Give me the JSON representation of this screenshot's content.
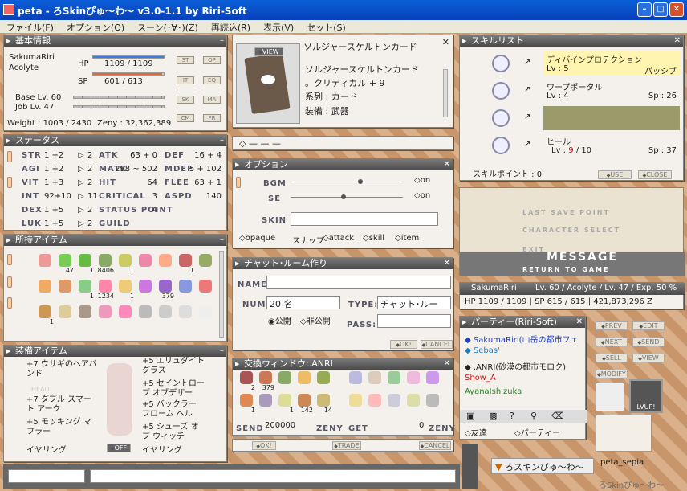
{
  "title": "peta - ろSkinぴゅ～わ～ v3.0-1.1 by Riri-Soft",
  "menu": [
    "ファイル(F)",
    "オプション(O)",
    "スーン(･∀･)(Z)",
    "再読込(R)",
    "表示(V)",
    "セット(S)"
  ],
  "basic": {
    "header": "基本情報",
    "name": "SakumaRiri",
    "job": "Acolyte",
    "hp_label": "HP",
    "hp": "1109 / 1109",
    "sp_label": "SP",
    "sp": "601 / 613",
    "hp_frac": 1.0,
    "sp_frac": 0.98,
    "base": "Base Lv. 60",
    "joblv": "Job Lv. 47",
    "weight": "Weight : 1003 / 2430",
    "zeny": "Zeny : 32,362,389",
    "btns": [
      "ST",
      "OP",
      "IT",
      "EQ",
      "SK",
      "MA",
      "CM",
      "FR"
    ]
  },
  "status": {
    "header": "ステータス",
    "rows": [
      {
        "k": "STR",
        "v": "1 +2",
        "p": "2",
        "k2": "ATK",
        "v2": "63 + 0",
        "k3": "DEF",
        "v3": "16 + 4"
      },
      {
        "k": "AGI",
        "v": "1 +2",
        "p": "2",
        "k2": "MATK",
        "v2": "298 ~ 502",
        "k3": "MDEF",
        "v3": "5 + 102"
      },
      {
        "k": "VIT",
        "v": "1 +3",
        "p": "2",
        "k2": "HIT",
        "v2": "64",
        "k3": "FLEE",
        "v3": "63 + 1"
      },
      {
        "k": "INT",
        "v": "92+10",
        "p": "11",
        "k2": "CRITICAL",
        "v2": "3",
        "k3": "ASPD",
        "v3": "140"
      },
      {
        "k": "DEX",
        "v": "1 +5",
        "p": "2",
        "k2": "STATUS POINT",
        "v2": "4",
        "k3": "",
        "v3": ""
      },
      {
        "k": "LUK",
        "v": "1 +5",
        "p": "2",
        "k2": "GUILD",
        "v2": "",
        "k3": "",
        "v3": ""
      }
    ]
  },
  "items": {
    "header": "所持アイテム",
    "counts": [
      "",
      "47",
      "1",
      "8406",
      "1",
      "",
      "",
      "1",
      "",
      "",
      "",
      "1",
      "1234",
      "1",
      "",
      "379",
      "",
      "",
      "1",
      "",
      "",
      "",
      "",
      "",
      "",
      "",
      ""
    ]
  },
  "equip": {
    "header": "装備アイテム",
    "left": [
      "+7 ウサギのヘアバンド",
      "HEAD",
      "+7 ダブル スマート アーク",
      "+5 モッキング マフラー",
      "イヤリング"
    ],
    "right": [
      "+5 エリュダイト グラス",
      "+5 セイントローブ オブデザー",
      "+5 バックラー フローム ヘル",
      "+5 シューズ オブ ウィッチ",
      "イヤリング"
    ],
    "off": "OFF"
  },
  "card": {
    "title": "ソルジャースケルトンカード",
    "name": "ソルジャースケルトンカード",
    "effect": "。クリティカル + 9",
    "type_label": "系列 : カード",
    "equip_label": "装備 : 武器",
    "view": "VIEW"
  },
  "option": {
    "header": "オプション",
    "bgm": "BGM",
    "se": "SE",
    "skin": "SKIN",
    "on": "on",
    "opaque": "opaque",
    "snap": "スナップ",
    "attack": "attack",
    "skill": "skill",
    "item": "item",
    "bgm_frac": 0.6,
    "se_frac": 0.45
  },
  "chat": {
    "header": "チャット･ルーム作り",
    "name_label": "NAME:",
    "num_label": "NUM:",
    "num": "20 名",
    "type_label": "TYPE:",
    "type": "チャット･ルー",
    "public": "公開",
    "private": "非公開",
    "pass_label": "PASS:",
    "ok": "OK!",
    "cancel": "CANCEL"
  },
  "trade": {
    "header": "交換ウィンドウ:.ANRI",
    "send": "SEND",
    "zeny_val": "200000",
    "zeny": "ZENY",
    "get": "GET",
    "get_val": "0",
    "ok": "OK!",
    "trade": "TRADE",
    "cancel": "CANCEL",
    "counts": [
      "2",
      "379",
      "",
      "",
      "",
      "1",
      "",
      "1",
      "142",
      "14"
    ]
  },
  "skills": {
    "header": "スキルリスト",
    "list": [
      {
        "name": "ディバインプロテクション",
        "lv": "Lv : 5",
        "info": "パッシブ"
      },
      {
        "name": "ワープポータル",
        "lv": "Lv : 4",
        "info": "Sp : 26"
      },
      {
        "name": "",
        "lv": "",
        "info": ""
      },
      {
        "name": "ヒール",
        "lv": "Lv : ",
        "lvcur": "9",
        "lvmax": "/ 10",
        "info": "Sp : 37"
      }
    ],
    "points": "スキルポイント : 0",
    "use": "USE",
    "close": "CLOSE"
  },
  "sys": {
    "items": [
      "LAST SAVE POINT",
      "CHARACTER SELECT",
      "EXIT",
      "RETURN TO GAME"
    ],
    "message": "MESSAGE"
  },
  "char": {
    "name": "SakumaRiri",
    "info": "Lv. 60 / Acolyte / Lv. 47 / Exp. 50 %",
    "hp": "HP 1109 / 1109 | SP 615 / 615 | 421,873,296 Z"
  },
  "party": {
    "header": "パーティー(Riri-Soft)",
    "members": [
      "SakumaRiri(山岳の都市フェ",
      "Sebas'",
      ".ANRI(砂漠の都市モロク)",
      "Show_A",
      "AyanaIshizuka"
    ],
    "colors": [
      "#1c3fc4",
      "#1c7fc4",
      "#222",
      "#c41c1c",
      "#1c8c1c"
    ],
    "tab_friend": "友達",
    "tab_party": "パーティー",
    "btns": [
      "PREV",
      "EDIT",
      "NEXT",
      "SEND",
      "SELL",
      "VIEW",
      "MODIFY"
    ],
    "lvup": "LVUP!"
  },
  "bottom": {
    "task": "ろスキンぴゅ～わ～",
    "user": "peta_sepia",
    "brand": "ろSkinぴゅ～わ～"
  }
}
